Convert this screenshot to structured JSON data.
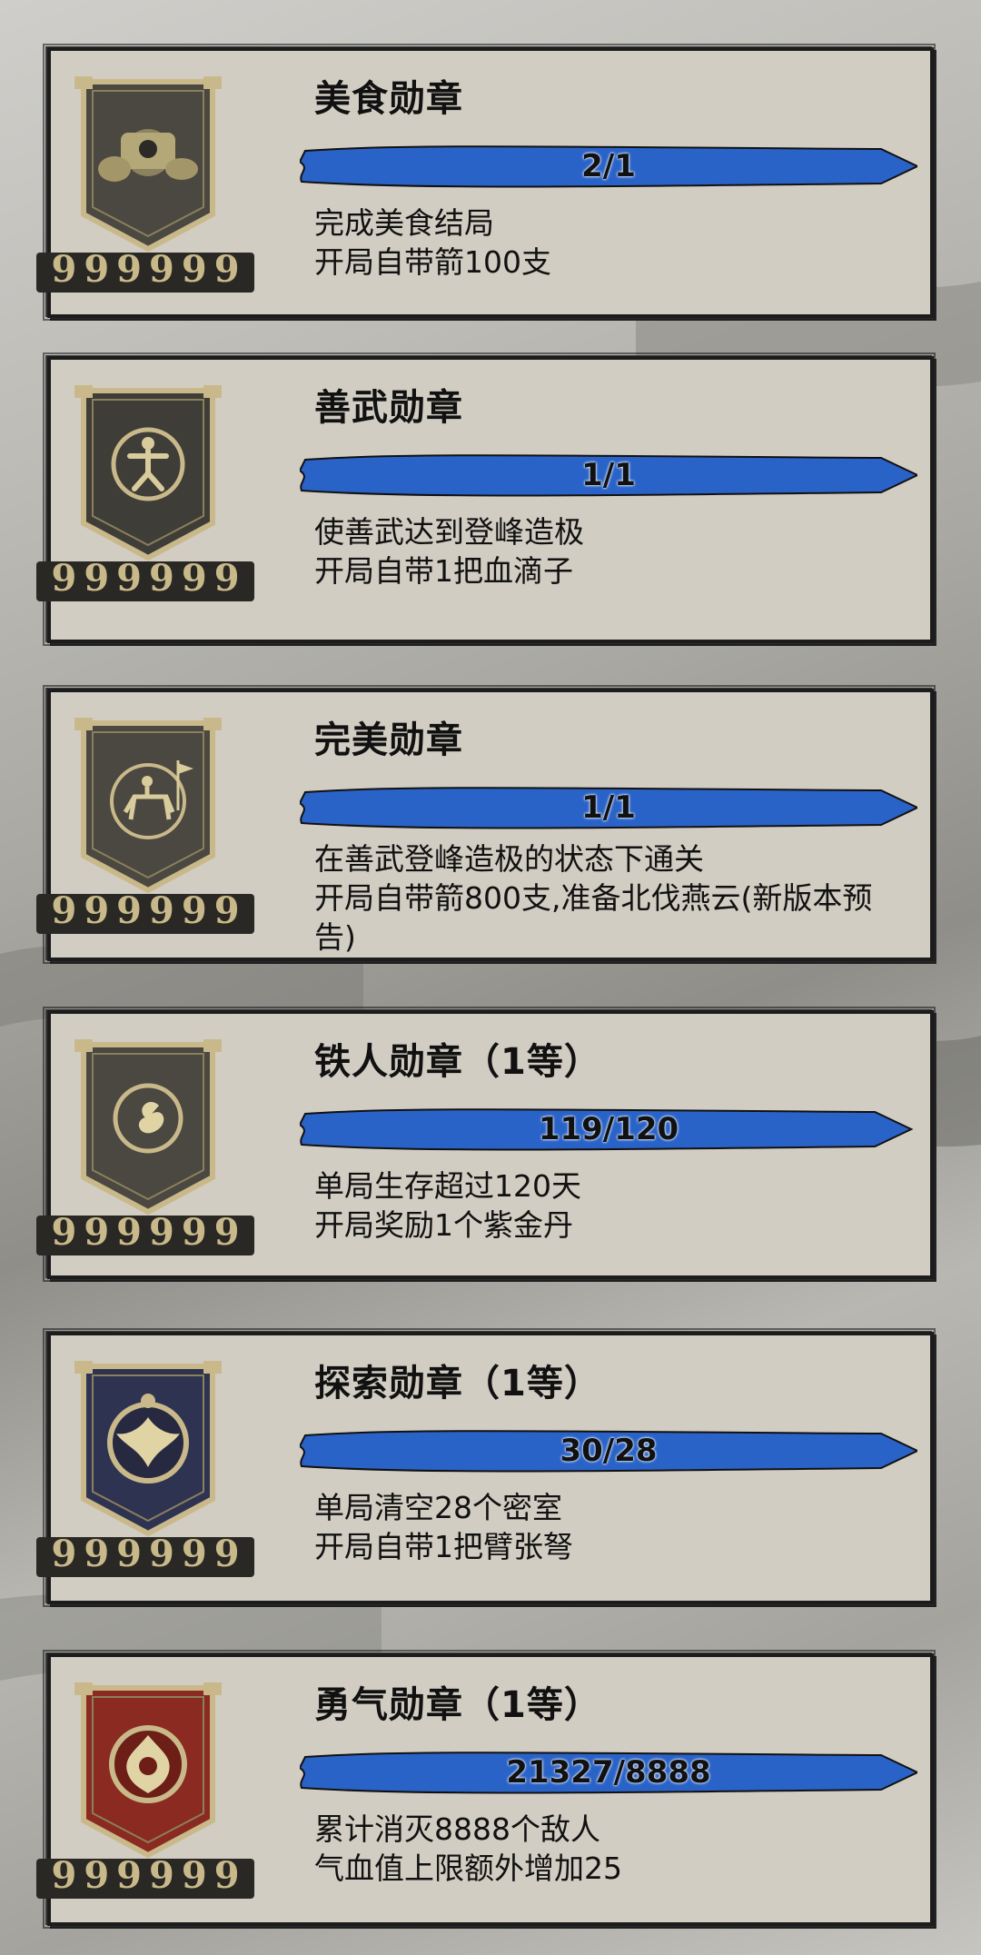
{
  "medals": [
    {
      "title": "美食勋章",
      "progress": "2/1",
      "fill": 1.0,
      "line1": "完成美食结局",
      "line2": "开局自带箭100支",
      "theme": "food-icon",
      "badge_color": "#4a4840"
    },
    {
      "title": "善武勋章",
      "progress": "1/1",
      "fill": 1.0,
      "line1": "使善武达到登峰造极",
      "line2": "开局自带1把血滴子",
      "theme": "martial-artist-icon",
      "badge_color": "#3f3d37"
    },
    {
      "title": "完美勋章",
      "progress": "1/1",
      "fill": 1.0,
      "line1": "在善武登峰造极的状态下通关",
      "line2": "开局自带箭800支,准备北伐燕云(新版本预告)",
      "theme": "horseman-icon",
      "badge_color": "#4a4840"
    },
    {
      "title": "铁人勋章（1等）",
      "progress": "119/120",
      "fill": 0.99,
      "line1": "单局生存超过120天",
      "line2": "开局奖励1个紫金丹",
      "theme": "swirl-icon",
      "badge_color": "#4a4840"
    },
    {
      "title": "探索勋章（1等）",
      "progress": "30/28",
      "fill": 1.0,
      "line1": "单局清空28个密室",
      "line2": "开局自带1把臂张弩",
      "theme": "phoenix-icon",
      "badge_color": "#2f3352"
    },
    {
      "title": "勇气勋章（1等）",
      "progress": "21327/8888",
      "fill": 1.0,
      "line1": "累计消灭8888个敌人",
      "line2": "气血值上限额外增加25",
      "theme": "flame-icon",
      "badge_color": "#8a2a20"
    }
  ],
  "star_glyph": "9",
  "star_count": 6,
  "colors": {
    "bar": "#2a63c8",
    "card": "#d2cdc3",
    "border": "#1c1c1c",
    "gold": "#c9b98a"
  }
}
